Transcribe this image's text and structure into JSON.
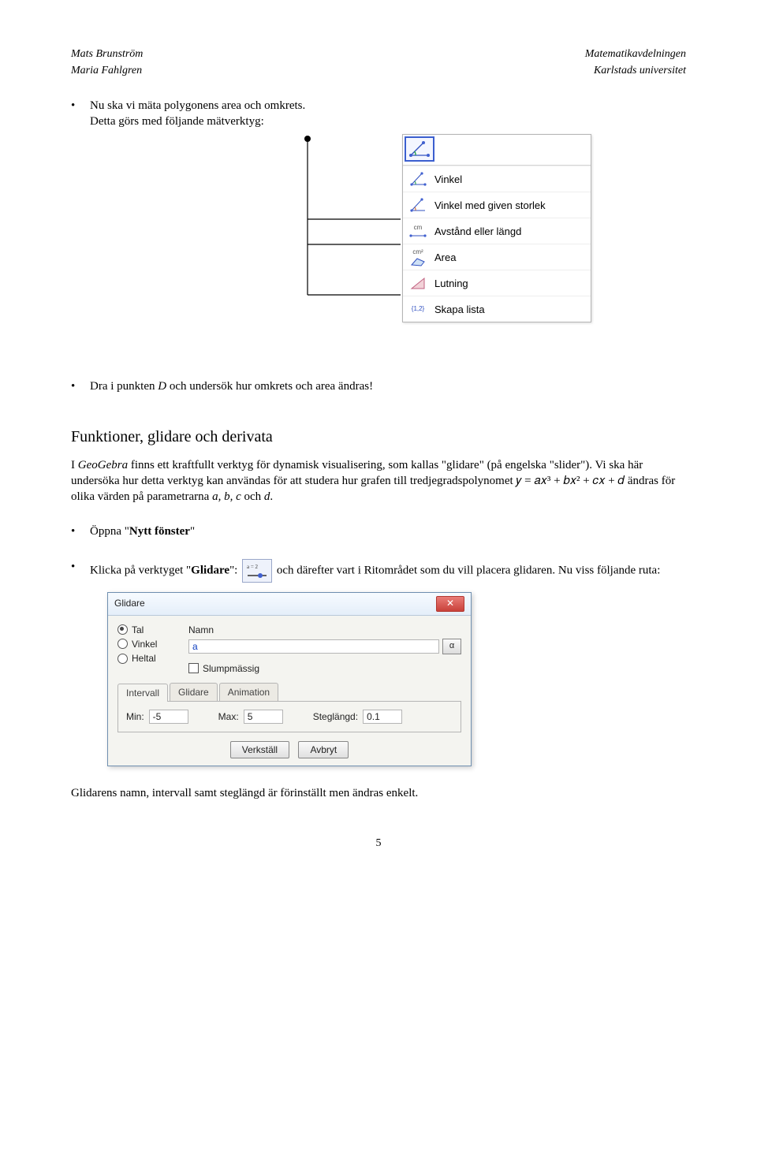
{
  "header": {
    "left_top": "Mats Brunström",
    "left_bottom": "Maria Fahlgren",
    "right_top": "Matematikavdelningen",
    "right_bottom": "Karlstads universitet"
  },
  "bullet1": "Nu ska vi mäta polygonens area och omkrets.",
  "bullet1_line2": "Detta görs med följande mätverktyg:",
  "toolbar_menu": {
    "items": [
      "Vinkel",
      "Vinkel med given storlek",
      "Avstånd eller längd",
      "Area",
      "Lutning",
      "Skapa lista"
    ],
    "distance_unit": "cm",
    "area_unit": "cm²",
    "list_sym": "{1,2}"
  },
  "bullet2_pre": "Dra i punkten ",
  "bullet2_point": "D",
  "bullet2_post": " och undersök hur omkrets och area ändras!",
  "section_title": "Funktioner, glidare och derivata",
  "para1_pre": "I ",
  "para1_app": "GeoGebra",
  "para1_post": "  finns ett kraftfullt verktyg för dynamisk visualisering, som kallas \"glidare\" (på engelska \"slider\"). Vi ska här undersöka hur detta verktyg kan användas för att studera hur grafen till tredjegradspolynomet 𝑦 = 𝑎𝑥³ + 𝑏𝑥² + 𝑐𝑥 + 𝑑 ändras för olika värden på parametrarna ",
  "para1_params": "a, b, c",
  "para1_and": " och ",
  "para1_last": "d",
  "para1_period": ".",
  "bullet3_pre": "Öppna \"",
  "bullet3_bold": "Nytt fönster",
  "bullet3_post": "\"",
  "bullet4_pre": "Klicka på verktyget \"",
  "bullet4_bold": "Glidare",
  "bullet4_mid": "\":",
  "bullet4_post": " och därefter vart i Ritområdet som du vill placera glidaren. Nu viss följande ruta:",
  "glidare_icon_label": "a = 2",
  "dialog": {
    "title": "Glidare",
    "radios": [
      "Tal",
      "Vinkel",
      "Heltal"
    ],
    "name_label": "Namn",
    "name_value": "a",
    "alpha": "α",
    "random_label": "Slumpmässig",
    "tabs": [
      "Intervall",
      "Glidare",
      "Animation"
    ],
    "min_label": "Min:",
    "min_value": "-5",
    "max_label": "Max:",
    "max_value": "5",
    "step_label": "Steglängd:",
    "step_value": "0.1",
    "ok": "Verkställ",
    "cancel": "Avbryt"
  },
  "para2": "Glidarens namn, intervall samt steglängd är förinställt men ändras enkelt.",
  "page_num": "5"
}
